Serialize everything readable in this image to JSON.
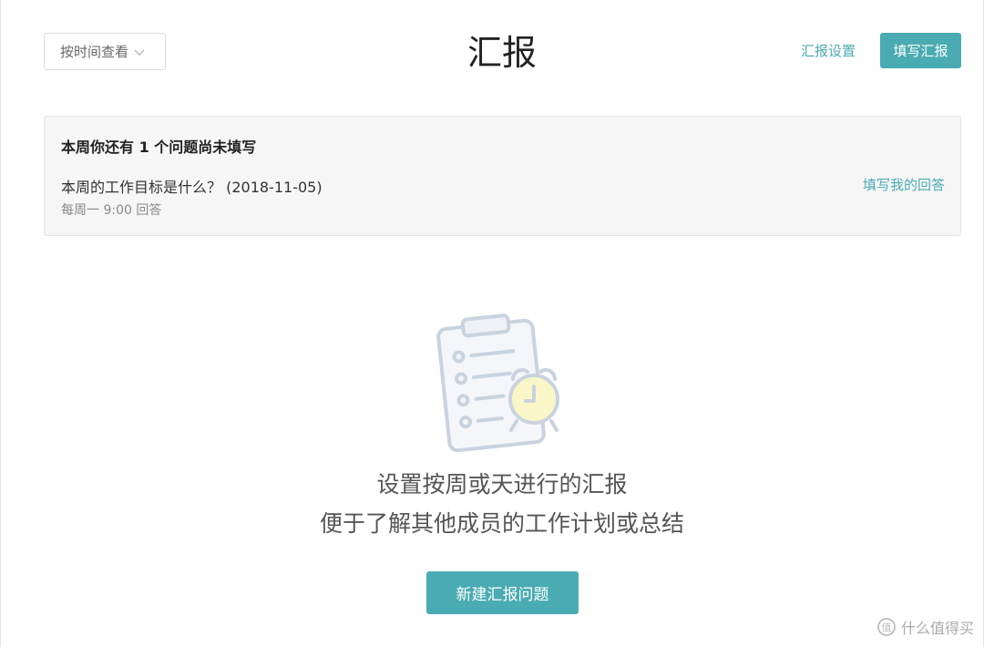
{
  "header": {
    "view_select": "按时间查看",
    "title": "汇报",
    "settings_link": "汇报设置",
    "fill_button": "填写汇报"
  },
  "notice": {
    "heading": "本周你还有 1 个问题尚未填写",
    "question": "本周的工作目标是什么？ (2018-11-05)",
    "schedule": "每周一 9:00 回答",
    "answer_link": "填写我的回答"
  },
  "empty_state": {
    "line1": "设置按周或天进行的汇报",
    "line2": "便于了解其他成员的工作计划或总结",
    "create_button": "新建汇报问题",
    "illustration_icon": "clipboard-alarm-clock-icon"
  },
  "watermark": {
    "icon": "smzdm-logo-icon",
    "text": "什么值得买"
  },
  "colors": {
    "accent": "#4aabb2",
    "notice_bg": "#f6f6f6",
    "illustration_stroke": "#c9d3e0",
    "clock_fill": "#fbf6c8"
  }
}
